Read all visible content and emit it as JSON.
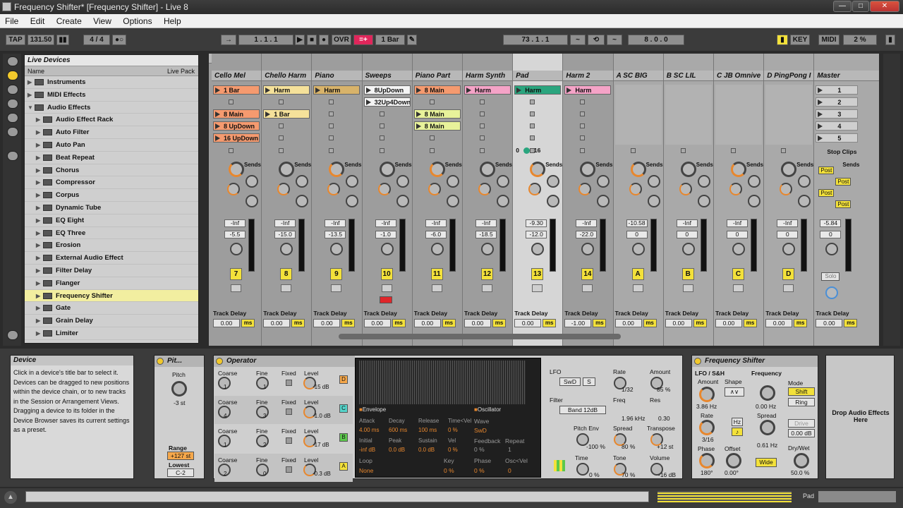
{
  "window": {
    "title": "Frequency Shifter*  [Frequency Shifter] - Live 8",
    "min": "—",
    "max": "□",
    "close": "✕"
  },
  "menu": [
    "File",
    "Edit",
    "Create",
    "View",
    "Options",
    "Help"
  ],
  "transport": {
    "tap": "TAP",
    "tempo": "131.50",
    "sig": "4 / 4",
    "ovr": "OVR",
    "position": "1 .   1 .   1",
    "quant": "1 Bar",
    "position2": "73 .   1 .   1",
    "loop_len": "8 .   0 .   0",
    "key": "KEY",
    "midi": "MIDI",
    "cpu": "2 %"
  },
  "browser": {
    "title": "Live Devices",
    "col_name": "Name",
    "col_pack": "Live Pack",
    "items": [
      {
        "label": "Instruments",
        "level": 0,
        "selected": false
      },
      {
        "label": "MIDI Effects",
        "level": 0,
        "selected": false
      },
      {
        "label": "Audio Effects",
        "level": 0,
        "selected": false
      },
      {
        "label": "Audio Effect Rack",
        "level": 1,
        "selected": false
      },
      {
        "label": "Auto Filter",
        "level": 1,
        "selected": false
      },
      {
        "label": "Auto Pan",
        "level": 1,
        "selected": false
      },
      {
        "label": "Beat Repeat",
        "level": 1,
        "selected": false
      },
      {
        "label": "Chorus",
        "level": 1,
        "selected": false
      },
      {
        "label": "Compressor",
        "level": 1,
        "selected": false
      },
      {
        "label": "Corpus",
        "level": 1,
        "selected": false
      },
      {
        "label": "Dynamic Tube",
        "level": 1,
        "selected": false
      },
      {
        "label": "EQ Eight",
        "level": 1,
        "selected": false
      },
      {
        "label": "EQ Three",
        "level": 1,
        "selected": false
      },
      {
        "label": "Erosion",
        "level": 1,
        "selected": false
      },
      {
        "label": "External Audio Effect",
        "level": 1,
        "selected": false
      },
      {
        "label": "Filter Delay",
        "level": 1,
        "selected": false
      },
      {
        "label": "Flanger",
        "level": 1,
        "selected": false
      },
      {
        "label": "Frequency Shifter",
        "level": 1,
        "selected": true
      },
      {
        "label": "Gate",
        "level": 1,
        "selected": false
      },
      {
        "label": "Grain Delay",
        "level": 1,
        "selected": false
      },
      {
        "label": "Limiter",
        "level": 1,
        "selected": false
      }
    ]
  },
  "session": {
    "sends_label": "Sends",
    "track_delay_label": "Track Delay",
    "stop_clips": "Stop Clips",
    "post": "Post",
    "solo": "Solo",
    "tracks": [
      {
        "name": "Cello Mel",
        "num": "7",
        "vol": "-Inf",
        "db": "-5.5",
        "delay": "0.00",
        "clips": [
          {
            "label": "1 Bar",
            "color": "#f59a6f",
            "row": 0
          },
          {
            "label": "8 Main",
            "color": "#f59a6f",
            "row": 2
          },
          {
            "label": "8 UpDown",
            "color": "#f59a6f",
            "row": 3
          },
          {
            "label": "16 UpDown",
            "color": "#f59a6f",
            "row": 4
          }
        ]
      },
      {
        "name": "Chello Harm",
        "num": "8",
        "vol": "-Inf",
        "db": "-15.0",
        "delay": "0.00",
        "clips": [
          {
            "label": "Harm",
            "color": "#f5e19a",
            "row": 0
          },
          {
            "label": "1 Bar",
            "color": "#f5e19a",
            "row": 2
          }
        ]
      },
      {
        "name": "Piano",
        "num": "9",
        "vol": "-Inf",
        "db": "-13.5",
        "delay": "0.00",
        "clips": [
          {
            "label": "Harm",
            "color": "#d8b36a",
            "row": 0
          }
        ]
      },
      {
        "name": "Sweeps",
        "num": "10",
        "vol": "-Inf",
        "db": "-1.0",
        "delay": "0.00",
        "clips": [
          {
            "label": "8UpDown",
            "color": "#f4f4f4",
            "row": 0
          },
          {
            "label": "32Up4Down",
            "color": "#f4f4f4",
            "row": 1
          }
        ]
      },
      {
        "name": "Piano Part",
        "num": "11",
        "vol": "-Inf",
        "db": "-6.0",
        "delay": "0.00",
        "clips": [
          {
            "label": "8 Main",
            "color": "#f59a6f",
            "row": 0
          },
          {
            "label": "8 Main",
            "color": "#e8f29a",
            "row": 2
          },
          {
            "label": "8 Main",
            "color": "#e8f29a",
            "row": 3
          }
        ]
      },
      {
        "name": "Harm Synth",
        "num": "12",
        "vol": "-Inf",
        "db": "-18.5",
        "delay": "0.00",
        "clips": [
          {
            "label": "Harm",
            "color": "#f5a3c7",
            "row": 0
          }
        ]
      },
      {
        "name": "Pad",
        "num": "13",
        "vol": "-9.30",
        "db": "-12.0",
        "delay": "0.00",
        "clips": [
          {
            "label": "Harm",
            "color": "#2aa57e",
            "row": 0
          }
        ]
      },
      {
        "name": "Harm 2",
        "num": "14",
        "vol": "-Inf",
        "db": "-22.0",
        "delay": "-1.00",
        "clips": [
          {
            "label": "Harm",
            "color": "#f5a3c7",
            "row": 0
          }
        ]
      },
      {
        "name": "A SC BIG",
        "num": "A",
        "vol": "-10.58",
        "db": "0",
        "delay": "0.00",
        "clips": []
      },
      {
        "name": "B SC LIL",
        "num": "B",
        "vol": "-Inf",
        "db": "0",
        "delay": "0.00",
        "clips": []
      },
      {
        "name": "C JB Omnive",
        "num": "C",
        "vol": "-Inf",
        "db": "0",
        "delay": "0.00",
        "clips": []
      },
      {
        "name": "D PingPong I",
        "num": "D",
        "vol": "-Inf",
        "db": "0",
        "delay": "0.00",
        "clips": []
      }
    ],
    "master": {
      "name": "Master",
      "scenes": [
        "1",
        "2",
        "3",
        "4",
        "5"
      ],
      "vol": "-5.84",
      "db": "0",
      "delay": "0.00"
    },
    "pad_clip_counter": {
      "a": "0",
      "b": "16"
    },
    "ms": "ms"
  },
  "info": {
    "title": "Device",
    "text": "Click in a device's title bar to select it. Devices can be dragged to new positions within the device chain, or to new tracks in the Session or Arrangement Views. Dragging a device to its folder in the Device Browser saves its current settings as a preset."
  },
  "pitch": {
    "title": "Pit...",
    "pitch_label": "Pitch",
    "pitch_val": "-3 st",
    "range_label": "Range",
    "range_val": "+127 st",
    "lowest_label": "Lowest",
    "lowest_val": "C-2"
  },
  "operator": {
    "title": "Operator",
    "osc_rows": [
      {
        "coarse": "1",
        "fine": "1",
        "level": "-15 dB",
        "tag": "D",
        "tagcolor": "#f5a74a"
      },
      {
        "coarse": "4",
        "fine": "3",
        "level": "-1.0 dB",
        "tag": "C",
        "tagcolor": "#55d3c9"
      },
      {
        "coarse": "1",
        "fine": "2",
        "level": "-17 dB",
        "tag": "B",
        "tagcolor": "#5cc84c"
      },
      {
        "coarse": "2",
        "fine": "0",
        "level": "-0.3 dB",
        "tag": "A",
        "tagcolor": "#f3e13a"
      }
    ],
    "coarse_label": "Coarse",
    "fine_label": "Fine",
    "fixed_label": "Fixed",
    "level_label": "Level",
    "envelope": "Envelope",
    "oscillator": "Oscillator",
    "env": [
      {
        "label": "Attack",
        "value": "4.00 ms"
      },
      {
        "label": "Decay",
        "value": "600 ms"
      },
      {
        "label": "Release",
        "value": "100 ms"
      },
      {
        "label": "Time<Vel",
        "value": "0 %"
      }
    ],
    "env2": [
      {
        "label": "Initial",
        "value": "-inf dB"
      },
      {
        "label": "Peak",
        "value": "0.0 dB"
      },
      {
        "label": "Sustain",
        "value": "0.0 dB"
      },
      {
        "label": "Vel",
        "value": "0 %"
      }
    ],
    "wave_label": "Wave",
    "wave_val": "SwD",
    "feedback_label": "Feedback",
    "feedback_val": "0 %",
    "repeat_label": "Repeat",
    "repeat_val": "1",
    "loop_label": "Loop",
    "loop_val": "None",
    "key_label": "Key",
    "key_val": "0 %",
    "phase_label": "Phase",
    "phase_val": "0 %",
    "oscvel_label": "Osc<Vel",
    "oscvel_val": "0",
    "lfo_label": "LFO",
    "lfo_wave": "SwD",
    "lfo_s": "S",
    "rate_label": "Rate",
    "rate_val": "1/32",
    "amount_label": "Amount",
    "amount_val": "85 %",
    "filter_label": "Filter",
    "filter_type": "Band 12dB",
    "freq_label": "Freq",
    "freq_val": "1.96 kHz",
    "res_label": "Res",
    "res_val": "0.30",
    "pitchenv_label": "Pitch Env",
    "pitchenv_val": "-100 %",
    "spread_label": "Spread",
    "spread_val": "80 %",
    "transpose_label": "Transpose",
    "transpose_val": "+12 st",
    "time_label": "Time",
    "time_val": "0 %",
    "tone_label": "Tone",
    "tone_val": "70 %",
    "volume_label": "Volume",
    "volume_val": "-16 dB"
  },
  "freqshift": {
    "title": "Frequency Shifter",
    "lfo_label": "LFO / S&H",
    "amount_label": "Amount",
    "amount_val": "3.86 Hz",
    "shape_label": "Shape",
    "hz_btn": "Hz",
    "rate_label": "Rate",
    "rate_val": "3/16",
    "phase_label": "Phase",
    "phase_val": "180°",
    "offset_label": "Offset",
    "offset_val": "0.00°",
    "frequency_label": "Frequency",
    "frequency_val": "0.00 Hz",
    "spread_label": "Spread",
    "spread_val": "0.61 Hz",
    "wide_btn": "Wide",
    "mode_label": "Mode",
    "shift_btn": "Shift",
    "ring_btn": "Ring",
    "drive_btn": "Drive",
    "drive_val": "0.00 dB",
    "drywet_label": "Dry/Wet",
    "drywet_val": "50.0 %"
  },
  "drop": {
    "text": "Drop Audio Effects Here"
  },
  "status": {
    "track_label": "Pad"
  }
}
